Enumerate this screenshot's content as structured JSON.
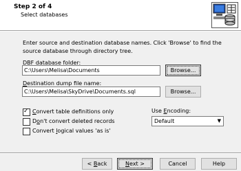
{
  "header": {
    "step": "Step 2 of 4",
    "subtitle": "Select databases"
  },
  "description": "Enter source and destination database names. Click 'Browse' to find the source database through directory tree.",
  "dbf": {
    "label_prefix": "DB",
    "label_underlined": "F",
    "label_suffix": " database folder:",
    "value": "C:\\Users\\Melisa\\Documents",
    "browse_label": "Browse..."
  },
  "dump": {
    "label_underlined": "D",
    "label_suffix": "estination dump file name:",
    "value": "C:\\Users\\Melisa\\SkyDrive\\Documents.sql",
    "browse_label": "Browse..."
  },
  "options": {
    "convert_table_defs": {
      "pre": "",
      "ul": "C",
      "post": "onvert table definitions only",
      "checked": true
    },
    "dont_convert_deleted": {
      "pre": "D",
      "ul": "o",
      "post": "n't convert deleted records",
      "checked": false
    },
    "convert_logical": {
      "pre": "Convert ",
      "ul": "l",
      "post": "ogical values 'as is'",
      "checked": false
    }
  },
  "encoding": {
    "label_pre": "Use ",
    "label_ul": "E",
    "label_post": "ncoding:",
    "selected": "Default"
  },
  "footer": {
    "back_pre": "< ",
    "back_ul": "B",
    "back_post": "ack",
    "next_pre": "",
    "next_ul": "N",
    "next_post": "ext >",
    "cancel": "Cancel",
    "help": "Help"
  }
}
